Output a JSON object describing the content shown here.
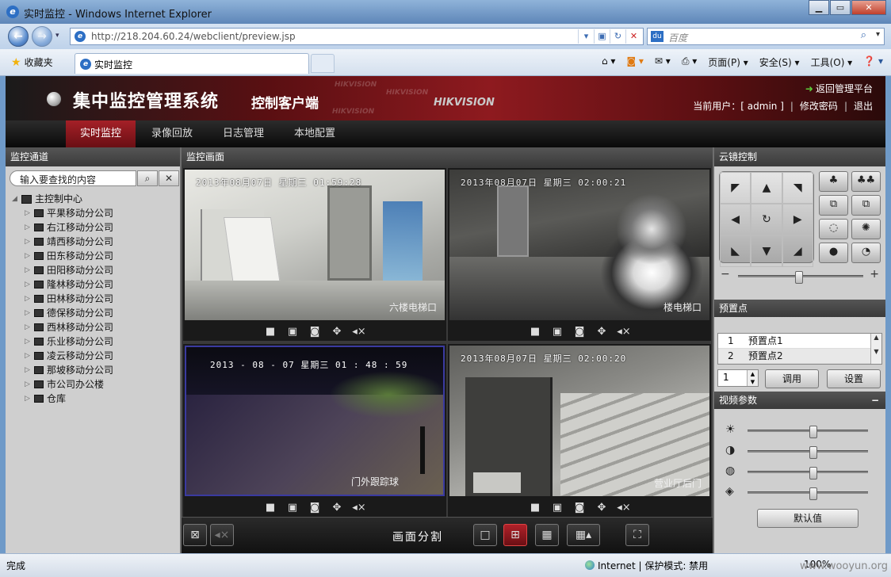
{
  "browser": {
    "title": "实时监控 - Windows Internet Explorer",
    "url": "http://218.204.60.24/webclient/preview.jsp",
    "search_placeholder": "百度",
    "favorites_label": "收藏夹",
    "tab_title": "实时监控",
    "commands": [
      "页面(P) ▾",
      "安全(S) ▾",
      "工具(O) ▾"
    ],
    "status_done": "完成",
    "status_zone": "Internet | 保护模式: 禁用",
    "zoom": "100%",
    "watermark": "www.wooyun.org"
  },
  "app": {
    "system_title": "集中监控管理系统",
    "client_title": "控制客户端",
    "brand": "HIKVISION",
    "back_link": "返回管理平台",
    "current_user_label": "当前用户：[ admin ]",
    "change_password": "修改密码",
    "logout": "退出",
    "colors": {
      "accent": "#8e1a1f",
      "menu_active": "#a52027"
    }
  },
  "menu": [
    {
      "label": "实时监控",
      "active": true
    },
    {
      "label": "录像回放",
      "active": false
    },
    {
      "label": "日志管理",
      "active": false
    },
    {
      "label": "本地配置",
      "active": false
    }
  ],
  "left_panel": {
    "title": "监控通道",
    "search_value": "输入要查找的内容",
    "root": "主控制中心",
    "nodes": [
      "平果移动分公司",
      "右江移动分公司",
      "靖西移动分公司",
      "田东移动分公司",
      "田阳移动分公司",
      "隆林移动分公司",
      "田林移动分公司",
      "德保移动分公司",
      "西林移动分公司",
      "乐业移动分公司",
      "凌云移动分公司",
      "那坡移动分公司",
      "市公司办公楼",
      "仓库"
    ]
  },
  "center_panel": {
    "title": "监控画面",
    "cameras": [
      {
        "osd": "2013年08月07日 星期三 01:59:28",
        "name": "六楼电梯口"
      },
      {
        "osd": "2013年08月07日 星期三 02:00:21",
        "name": "楼电梯口"
      },
      {
        "osd": "2013 - 08 - 07 星期三 01 : 48 : 59",
        "name": "门外跟踪球"
      },
      {
        "osd": "2013年08月07日 星期三 02:00:20",
        "name": "营业厅后门"
      }
    ],
    "split_label": "画面分割"
  },
  "right_panel": {
    "ptz_title": "云镜控制",
    "preset_title": "预置点",
    "presets": [
      {
        "num": "1",
        "name": "预置点1"
      },
      {
        "num": "2",
        "name": "预置点2"
      }
    ],
    "preset_input": "1",
    "call_button": "调用",
    "set_button": "设置",
    "video_params_title": "视频参数",
    "default_button": "默认值"
  }
}
